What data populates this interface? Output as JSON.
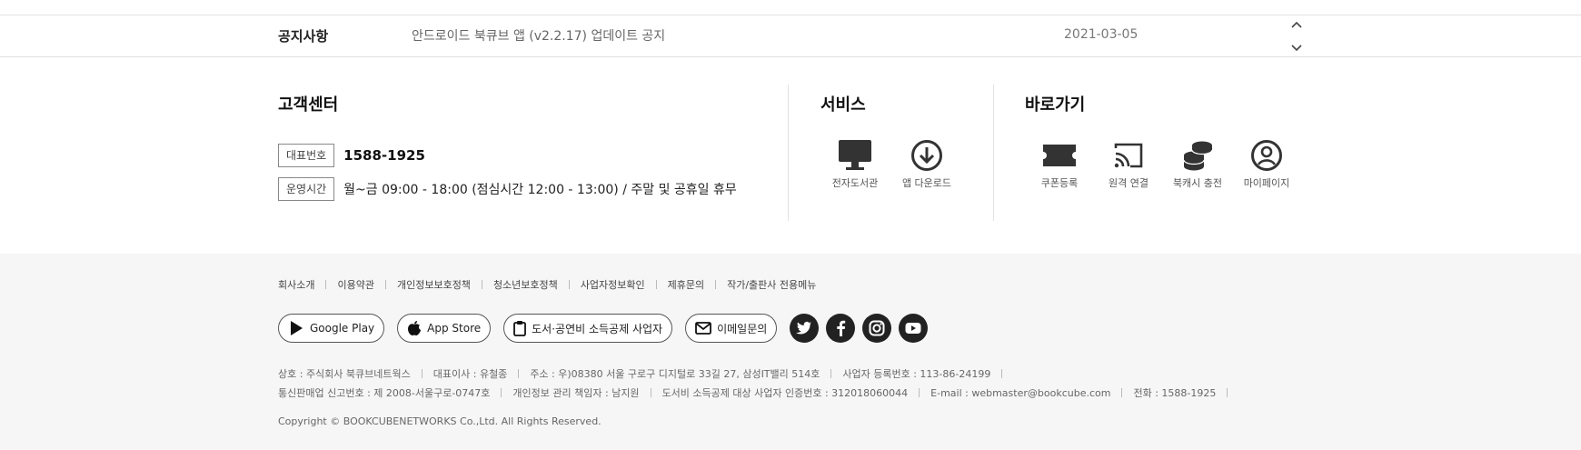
{
  "notice": {
    "title": "공지사항",
    "text": "안드로이드 북큐브 앱 (v2.2.17) 업데이트 공지",
    "date": "2021-03-05"
  },
  "customer_center": {
    "title": "고객센터",
    "phone_tag": "대표번호",
    "phone": "1588-1925",
    "hours_tag": "운영시간",
    "hours": "월~금 09:00 - 18:00 (점심시간 12:00 - 13:00) / 주말 및 공휴일 휴무"
  },
  "services": {
    "title": "서비스",
    "items": [
      {
        "label": "전자도서관",
        "icon": "monitor-icon"
      },
      {
        "label": "앱 다운로드",
        "icon": "download-icon"
      }
    ]
  },
  "shortcuts": {
    "title": "바로가기",
    "items": [
      {
        "label": "쿠폰등록",
        "icon": "ticket-icon"
      },
      {
        "label": "원격 연결",
        "icon": "cast-icon"
      },
      {
        "label": "북캐시 충전",
        "icon": "coins-icon"
      },
      {
        "label": "마이페이지",
        "icon": "user-circle-icon"
      }
    ]
  },
  "footer": {
    "links": [
      "회사소개",
      "이용약관",
      "개인정보보호정책",
      "청소년보호정책",
      "사업자정보확인",
      "제휴문의",
      "작가/출판사 전용메뉴"
    ],
    "buttons": {
      "google_play": "Google Play",
      "app_store": "App Store",
      "deduction": "도서·공연비 소득공제 사업자",
      "email": "이메일문의"
    },
    "sns": [
      "twitter-icon",
      "facebook-icon",
      "instagram-icon",
      "youtube-icon"
    ],
    "biz_line1": [
      "상호 : 주식회사 북큐브네트웍스",
      "대표이사 : 유철종",
      "주소 : 우)08380 서울 구로구 디지털로 33길 27, 삼성IT밸리 514호",
      "사업자 등록번호 : 113-86-24199"
    ],
    "biz_line2": [
      "통신판매업 신고번호 : 제 2008-서울구로-0747호",
      "개인정보 관리 책임자 : 남지원",
      "도서비 소득공제 대상 사업자 인증번호 : 312018060044",
      "E-mail : webmaster@bookcube.com",
      "전화 : 1588-1925"
    ],
    "copyright": "Copyright © BOOKCUBENETWORKS Co.,Ltd. All Rights Reserved."
  },
  "colors": {
    "footer_bg": "#f6f6f6",
    "sns_bg": "#222222",
    "divider": "#e2e2e2"
  }
}
